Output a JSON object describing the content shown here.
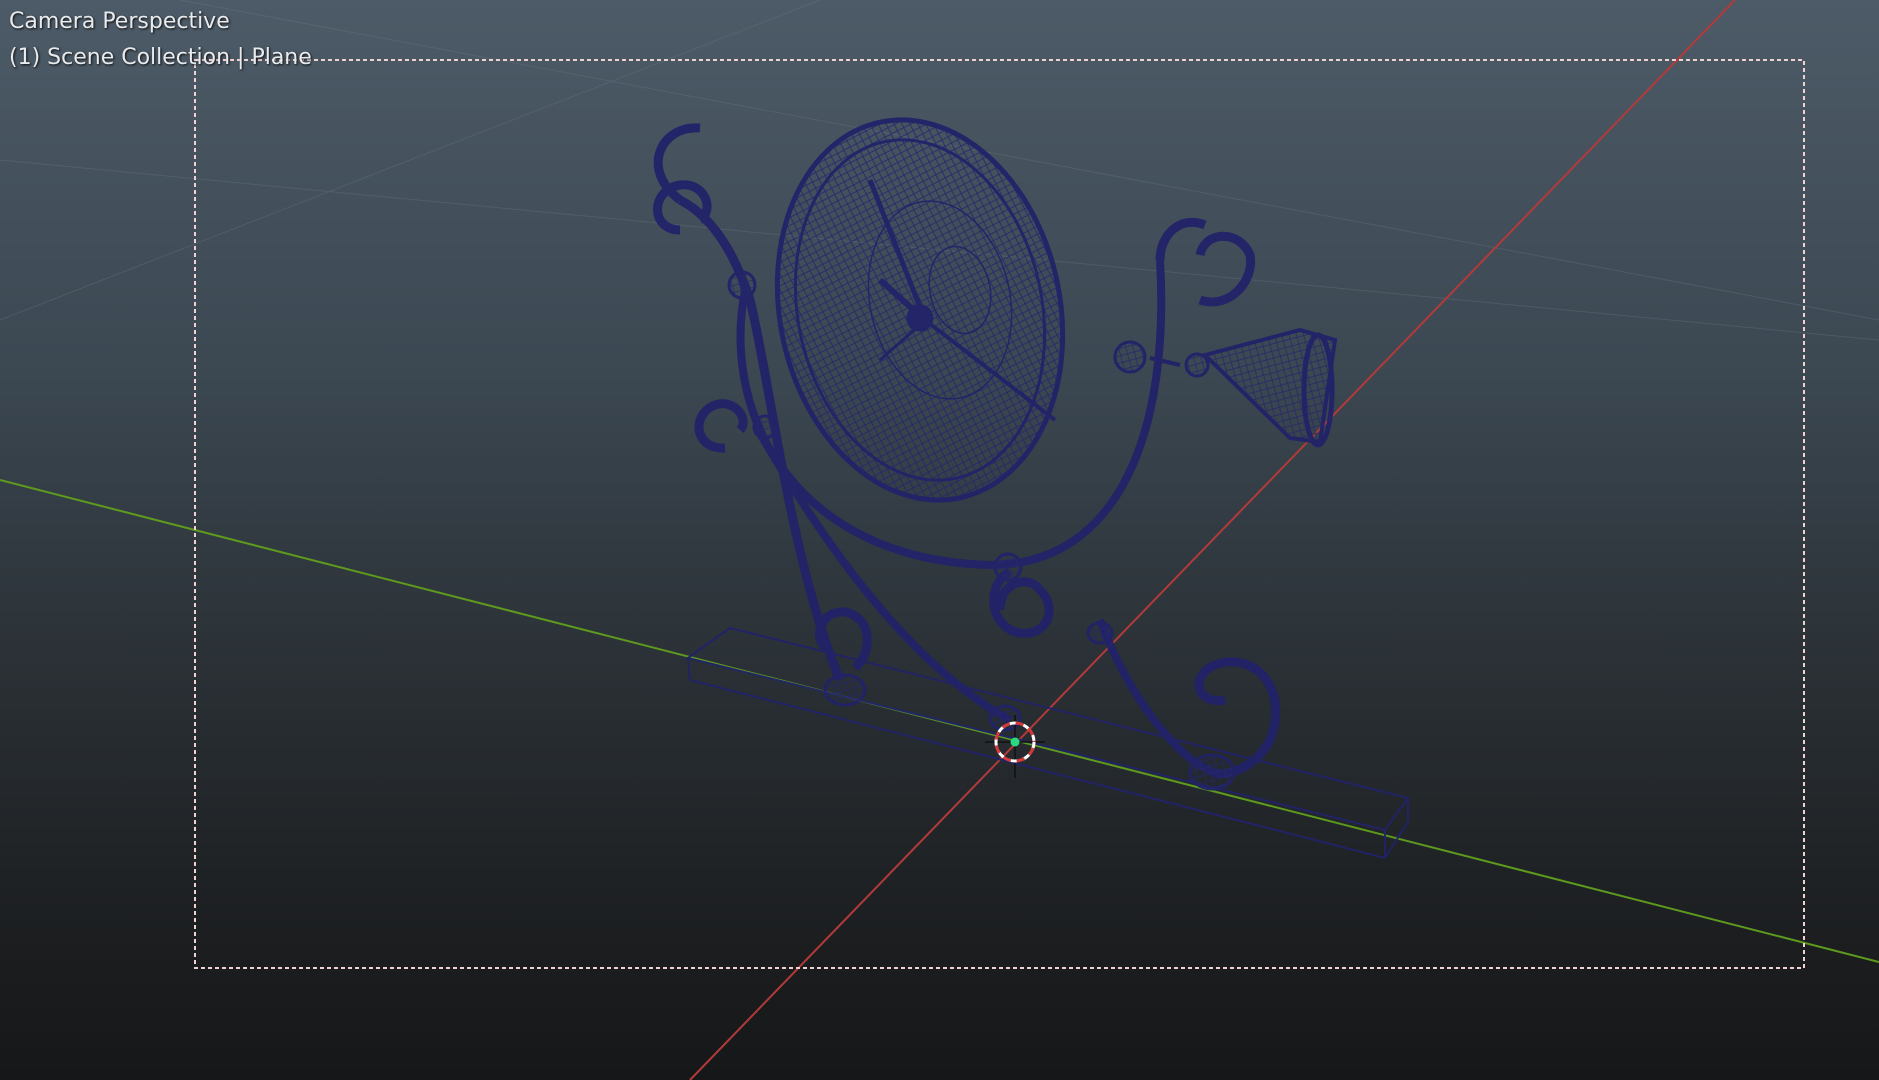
{
  "viewport": {
    "view_name": "Camera Perspective",
    "collection_info": "(1) Scene Collection | Plane"
  },
  "colors": {
    "background_top": "#4d5b68",
    "background_bottom": "#161718",
    "wireframe": "#22236a",
    "x_axis": "#b23a3a",
    "y_axis": "#5d9a1e",
    "camera_frame": "#f1d2d2"
  },
  "icons": {
    "cursor": "3d-cursor-icon",
    "origin": "object-origin-icon"
  }
}
